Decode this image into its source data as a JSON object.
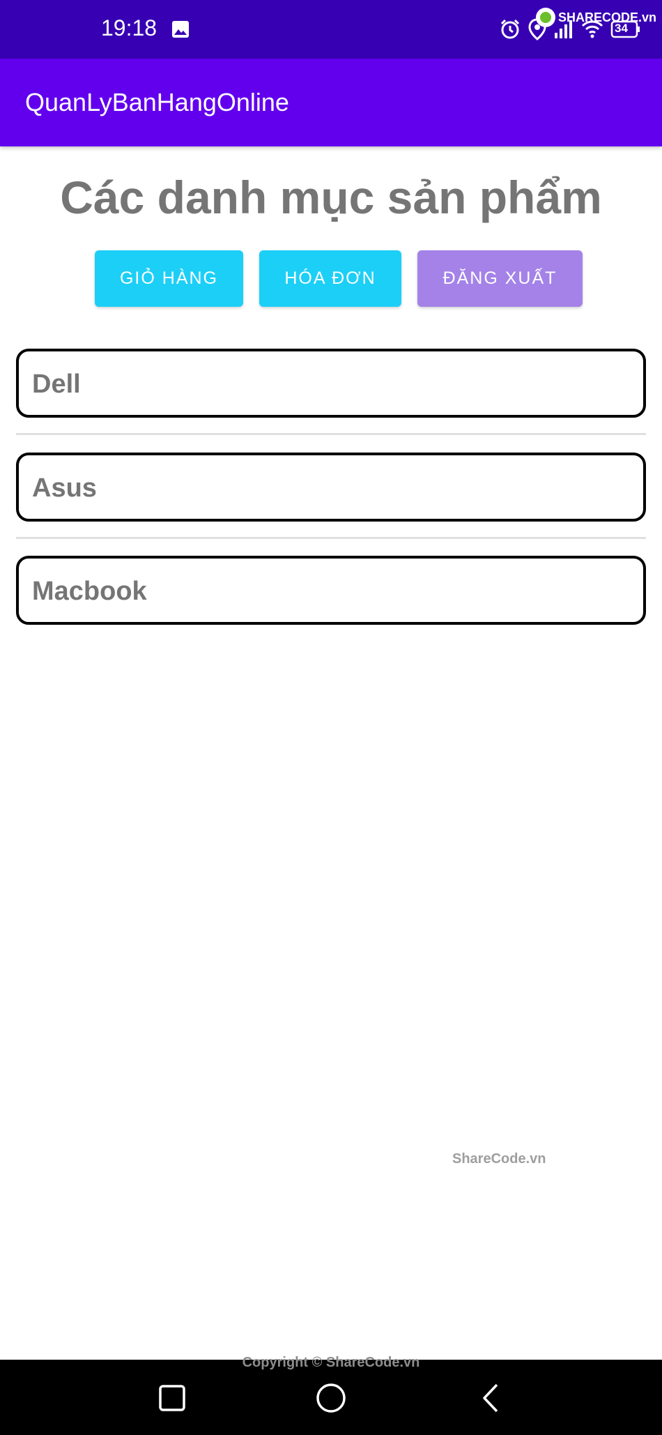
{
  "status_bar": {
    "time": "19:18",
    "battery": "34",
    "watermark_logo": "SHARECODE.vn",
    "icons": [
      "image-icon",
      "alarm-icon",
      "location-icon",
      "signal-icon",
      "wifi-icon",
      "battery-icon"
    ]
  },
  "app_bar": {
    "title": "QuanLyBanHangOnline"
  },
  "page": {
    "title": "Các danh mục sản phẩm"
  },
  "buttons": {
    "cart": "GIỎ HÀNG",
    "invoice": "HÓA ĐƠN",
    "logout": "ĐĂNG XUẤT"
  },
  "categories": [
    {
      "label": "Dell"
    },
    {
      "label": "Asus"
    },
    {
      "label": "Macbook"
    }
  ],
  "watermarks": {
    "center": "ShareCode.vn",
    "copyright": "Copyright © ShareCode.vn"
  },
  "colors": {
    "status_bar": "#3700b3",
    "app_bar": "#6200ee",
    "button_primary": "#1ccff7",
    "button_logout": "#a482e8",
    "heading_text": "#757575"
  }
}
